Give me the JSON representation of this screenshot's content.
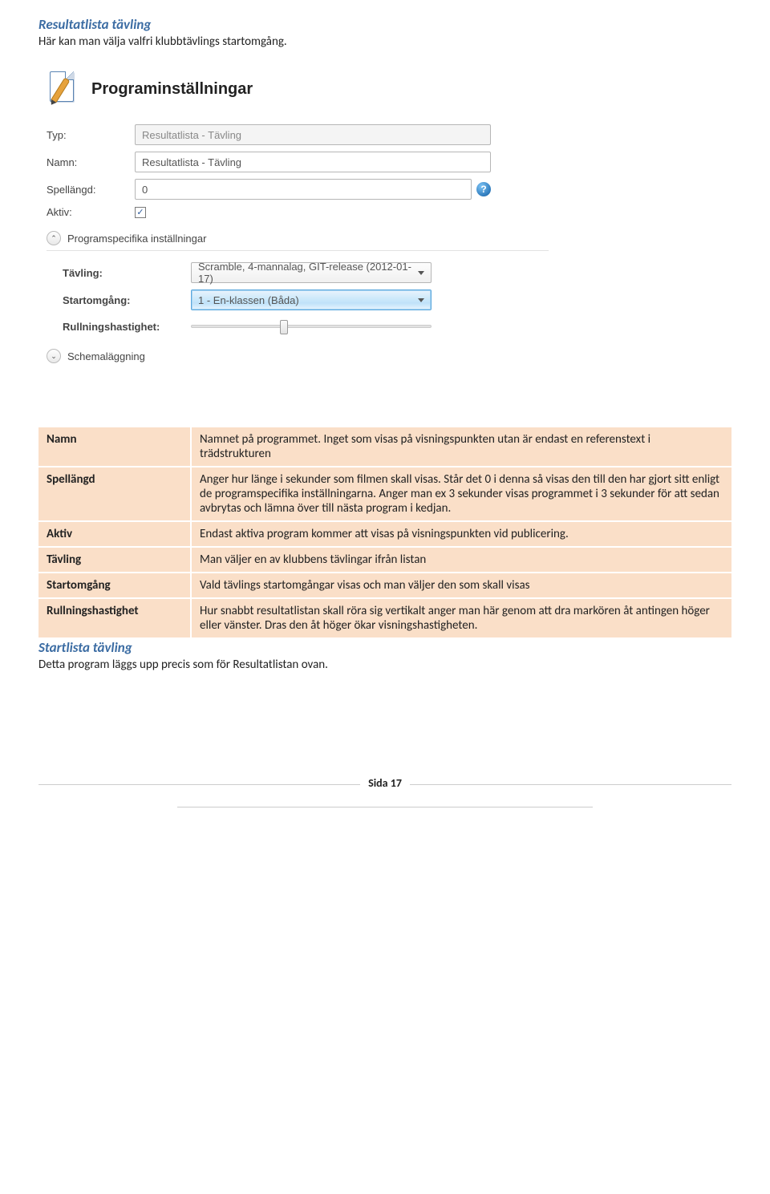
{
  "heading1": "Resultatlista tävling",
  "subline": "Här kan man välja valfri klubbtävlings startomgång.",
  "dialog": {
    "title": "Programinställningar",
    "labels": {
      "typ": "Typ:",
      "namn": "Namn:",
      "spellangd": "Spellängd:",
      "aktiv": "Aktiv:",
      "progspec": "Programspecifika inställningar",
      "tavling": "Tävling:",
      "startomgang": "Startomgång:",
      "rullning": "Rullningshastighet:",
      "schema": "Schemaläggning"
    },
    "values": {
      "typ": "Resultatlista - Tävling",
      "namn": "Resultatlista - Tävling",
      "spellangd": "0",
      "aktiv_check": "✓",
      "tavling": "Scramble, 4-mannalag, GIT-release (2012-01-17)",
      "startomgang": "1 - En-klassen (Båda)"
    },
    "help_glyph": "?",
    "chevron_up": "⌃",
    "chevron_down": "⌄"
  },
  "table": [
    {
      "key": "Namn",
      "desc": "Namnet på programmet. Inget som visas på visningspunkten utan är endast en referenstext i trädstrukturen"
    },
    {
      "key": "Spellängd",
      "desc": "Anger hur länge i sekunder som filmen skall visas. Står det 0 i denna så visas den till den har gjort sitt enligt de programspecifika inställningarna. Anger man ex 3 sekunder visas programmet i 3 sekunder för att sedan avbrytas och lämna över till nästa program i kedjan."
    },
    {
      "key": "Aktiv",
      "desc": "Endast aktiva program kommer att visas på visningspunkten vid publicering."
    },
    {
      "key": "Tävling",
      "desc": "Man väljer en av klubbens tävlingar ifrån listan"
    },
    {
      "key": "Startomgång",
      "desc": "Vald tävlings startomgångar visas och man väljer den som skall visas"
    },
    {
      "key": "Rullningshastighet",
      "desc": "Hur snabbt resultatlistan skall röra sig vertikalt anger man här genom att dra markören åt antingen höger eller vänster. Dras den åt höger ökar visningshastigheten."
    }
  ],
  "heading2": "Startlista tävling",
  "body2": "Detta program läggs upp precis som för Resultatlistan ovan.",
  "footer": "Sida 17"
}
